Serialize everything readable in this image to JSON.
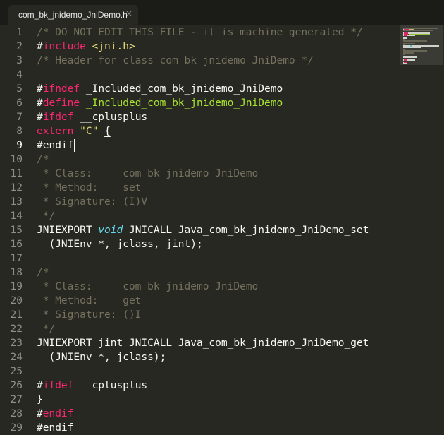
{
  "tab": {
    "title": "com_bk_jnidemo_JniDemo.h",
    "close_glyph": "×"
  },
  "editor": {
    "active_line": 9,
    "cursor_after_token": "#endif",
    "colors": {
      "background": "#272822",
      "text": "#f8f8f2",
      "comment": "#75715e",
      "keyword": "#f92672",
      "string": "#e6db74",
      "type": "#66d9ef",
      "name": "#a6e22e",
      "gutter_text": "#8f908a"
    },
    "lines": [
      {
        "num": "1",
        "tokens": [
          {
            "t": "/* DO NOT EDIT THIS FILE - it is machine generated */",
            "c": "comment"
          }
        ]
      },
      {
        "num": "2",
        "tokens": [
          {
            "t": "#",
            "c": "plain"
          },
          {
            "t": "include",
            "c": "pre"
          },
          {
            "t": " ",
            "c": "plain"
          },
          {
            "t": "<jni.h>",
            "c": "str"
          }
        ]
      },
      {
        "num": "3",
        "tokens": [
          {
            "t": "/* Header for class com_bk_jnidemo_JniDemo */",
            "c": "comment"
          }
        ]
      },
      {
        "num": "4",
        "tokens": []
      },
      {
        "num": "5",
        "tokens": [
          {
            "t": "#",
            "c": "plain"
          },
          {
            "t": "ifndef",
            "c": "pre"
          },
          {
            "t": " _Included_com_bk_jnidemo_JniDemo",
            "c": "plain"
          }
        ]
      },
      {
        "num": "6",
        "tokens": [
          {
            "t": "#",
            "c": "plain"
          },
          {
            "t": "define",
            "c": "pre"
          },
          {
            "t": " ",
            "c": "plain"
          },
          {
            "t": "_Included_com_bk_jnidemo_JniDemo",
            "c": "name"
          }
        ]
      },
      {
        "num": "7",
        "tokens": [
          {
            "t": "#",
            "c": "plain"
          },
          {
            "t": "ifdef",
            "c": "pre"
          },
          {
            "t": " __cplusplus",
            "c": "plain"
          }
        ]
      },
      {
        "num": "8",
        "tokens": [
          {
            "t": "extern",
            "c": "pre"
          },
          {
            "t": " ",
            "c": "plain"
          },
          {
            "t": "\"C\"",
            "c": "str"
          },
          {
            "t": " ",
            "c": "plain"
          },
          {
            "t": "{",
            "c": "plain",
            "u": true
          }
        ]
      },
      {
        "num": "9",
        "tokens": [
          {
            "t": "#endif",
            "c": "plain"
          }
        ]
      },
      {
        "num": "10",
        "tokens": [
          {
            "t": "/*",
            "c": "comment"
          }
        ]
      },
      {
        "num": "11",
        "tokens": [
          {
            "t": " * Class:     com_bk_jnidemo_JniDemo",
            "c": "comment"
          }
        ]
      },
      {
        "num": "12",
        "tokens": [
          {
            "t": " * Method:    set",
            "c": "comment"
          }
        ]
      },
      {
        "num": "13",
        "tokens": [
          {
            "t": " * Signature: (I)V",
            "c": "comment"
          }
        ]
      },
      {
        "num": "14",
        "tokens": [
          {
            "t": " */",
            "c": "comment"
          }
        ]
      },
      {
        "num": "15",
        "tokens": [
          {
            "t": "JNIEXPORT ",
            "c": "plain"
          },
          {
            "t": "void",
            "c": "type"
          },
          {
            "t": " JNICALL Java_com_bk_jnidemo_JniDemo_set",
            "c": "plain"
          }
        ]
      },
      {
        "num": "16",
        "tokens": [
          {
            "t": "  (JNIEnv *, jclass, jint);",
            "c": "plain"
          }
        ]
      },
      {
        "num": "17",
        "tokens": []
      },
      {
        "num": "18",
        "tokens": [
          {
            "t": "/*",
            "c": "comment"
          }
        ]
      },
      {
        "num": "19",
        "tokens": [
          {
            "t": " * Class:     com_bk_jnidemo_JniDemo",
            "c": "comment"
          }
        ]
      },
      {
        "num": "20",
        "tokens": [
          {
            "t": " * Method:    get",
            "c": "comment"
          }
        ]
      },
      {
        "num": "21",
        "tokens": [
          {
            "t": " * Signature: ()I",
            "c": "comment"
          }
        ]
      },
      {
        "num": "22",
        "tokens": [
          {
            "t": " */",
            "c": "comment"
          }
        ]
      },
      {
        "num": "23",
        "tokens": [
          {
            "t": "JNIEXPORT jint JNICALL Java_com_bk_jnidemo_JniDemo_get",
            "c": "plain"
          }
        ]
      },
      {
        "num": "24",
        "tokens": [
          {
            "t": "  (JNIEnv *, jclass);",
            "c": "plain"
          }
        ]
      },
      {
        "num": "25",
        "tokens": []
      },
      {
        "num": "26",
        "tokens": [
          {
            "t": "#",
            "c": "plain"
          },
          {
            "t": "ifdef",
            "c": "pre"
          },
          {
            "t": " __cplusplus",
            "c": "plain"
          }
        ]
      },
      {
        "num": "27",
        "tokens": [
          {
            "t": "}",
            "c": "plain",
            "u": true
          }
        ]
      },
      {
        "num": "28",
        "tokens": [
          {
            "t": "#",
            "c": "plain"
          },
          {
            "t": "endif",
            "c": "pre"
          }
        ]
      },
      {
        "num": "29",
        "tokens": [
          {
            "t": "#endif",
            "c": "plain"
          }
        ]
      }
    ]
  }
}
